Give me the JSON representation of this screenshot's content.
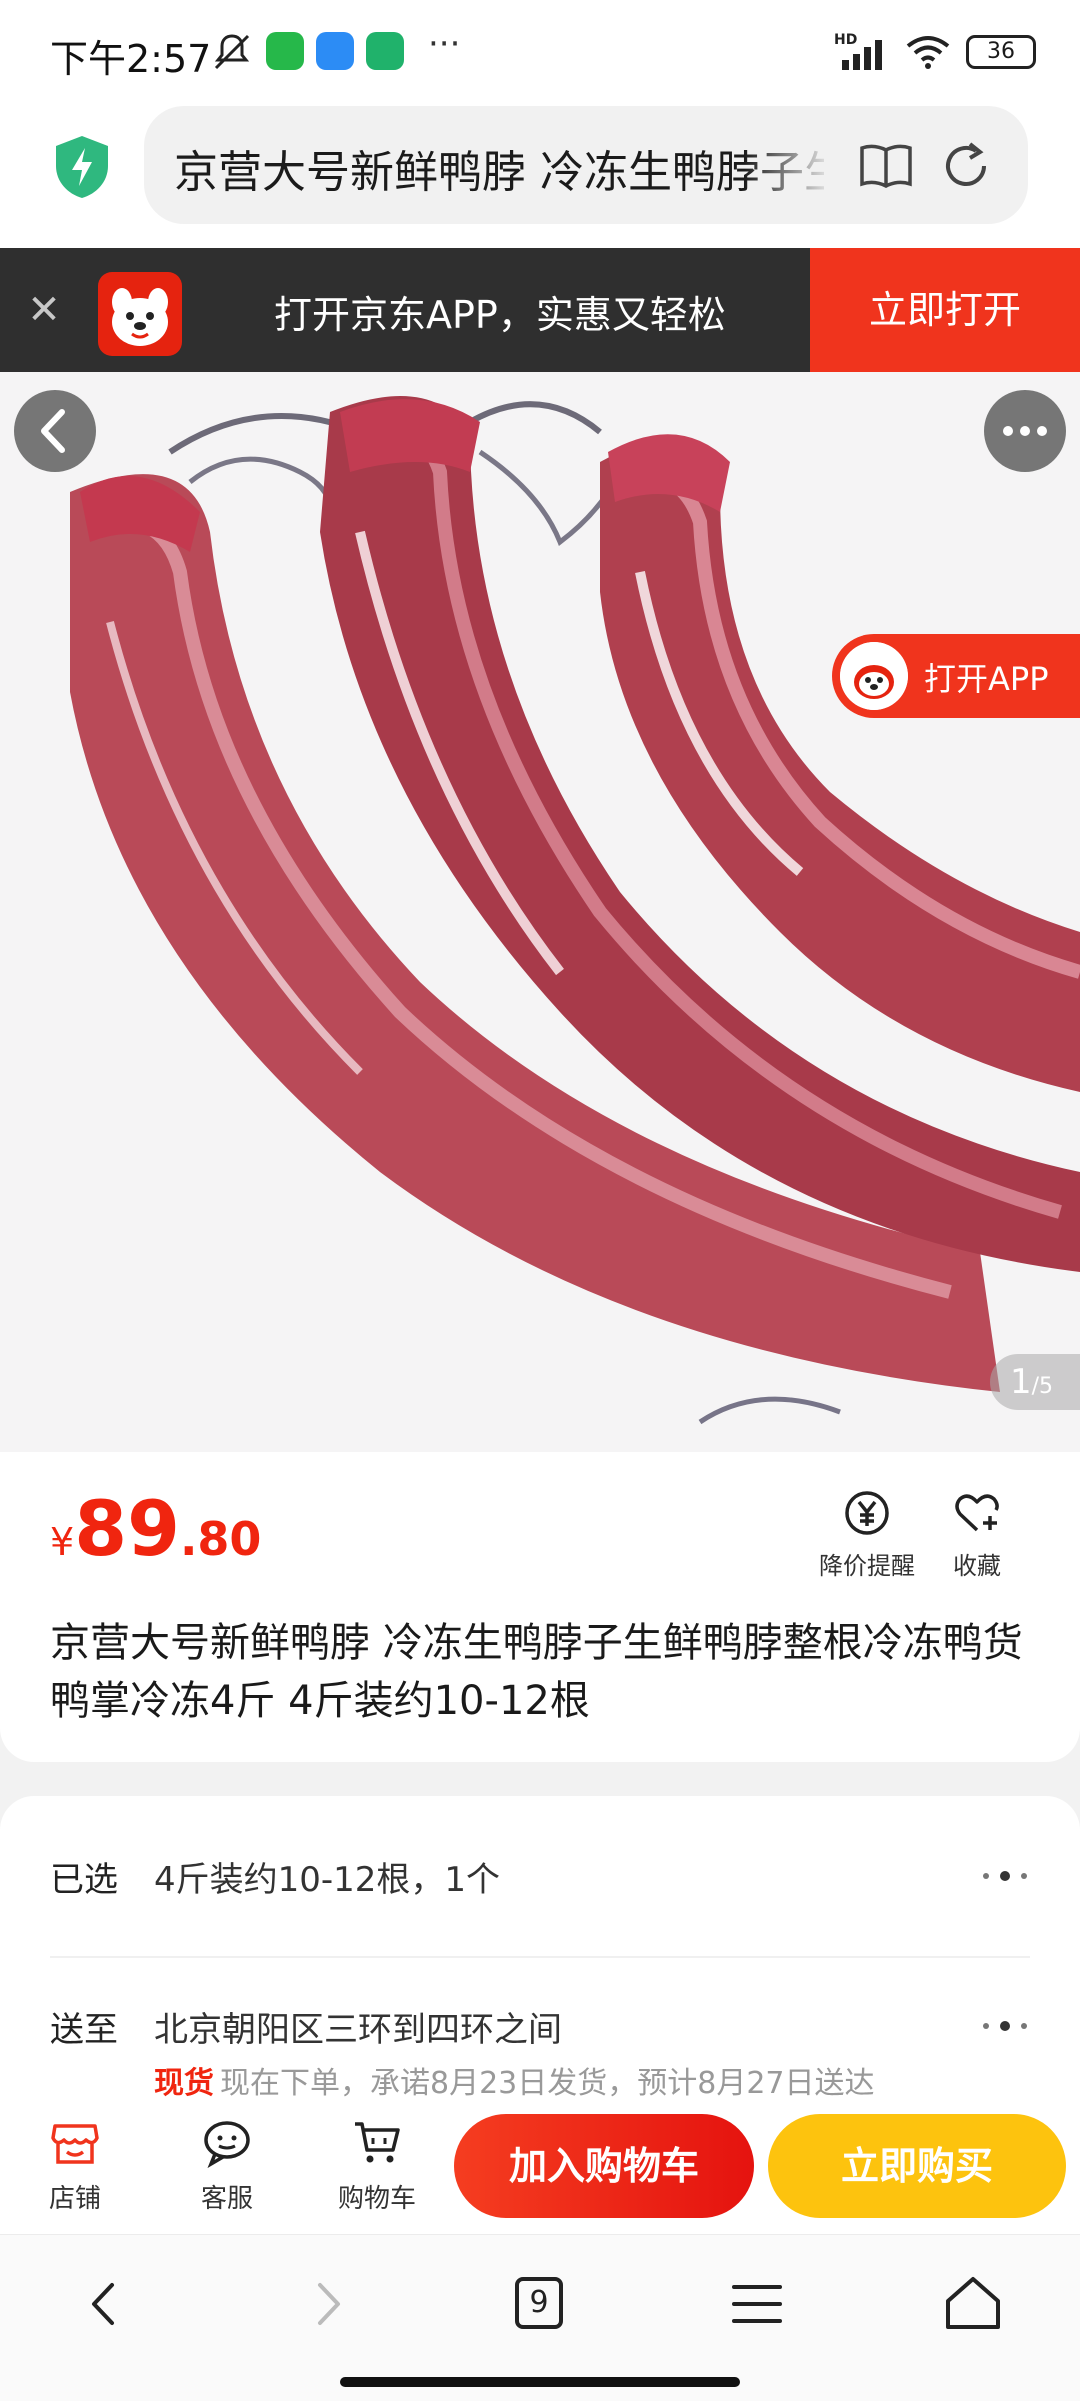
{
  "status_bar": {
    "time": "下午2:57",
    "more": "···",
    "battery": "36",
    "signal_tag": "HD"
  },
  "browser": {
    "url_text": "京营大号新鲜鸭脖 冷冻生鸭脖子生鲜鸭脖整根冷冻",
    "shield_color": "#2fb87f"
  },
  "app_banner": {
    "text": "打开京东APP，实惠又轻松",
    "open_button": "立即打开",
    "accent": "#f0341d"
  },
  "gallery": {
    "open_app_label": "打开APP",
    "counter_current": "1",
    "counter_total": "/5"
  },
  "product": {
    "currency": "¥",
    "price_int": "89",
    "price_dec": ".80",
    "price_alert_label": "降价提醒",
    "favorite_label": "收藏",
    "title": "京营大号新鲜鸭脖 冷冻生鸭脖子生鲜鸭脖整根冷冻鸭货鸭掌冷冻4斤 4斤装约10-12根"
  },
  "spec": {
    "selected_label": "已选",
    "selected_value": "4斤装约10-12根，1个",
    "delivery_label": "送至",
    "delivery_value": "北京朝阳区三环到四环之间",
    "stock_tag": "现货",
    "delivery_note": "现在下单，承诺8月23日发货，预计8月27日送达"
  },
  "action_bar": {
    "shop": "店铺",
    "service": "客服",
    "cart": "购物车",
    "add_to_cart": "加入购物车",
    "buy_now": "立即购买",
    "price_color": "#f0250f",
    "buy_color": "#fdc30e"
  },
  "nav": {
    "tab_count": "9"
  }
}
